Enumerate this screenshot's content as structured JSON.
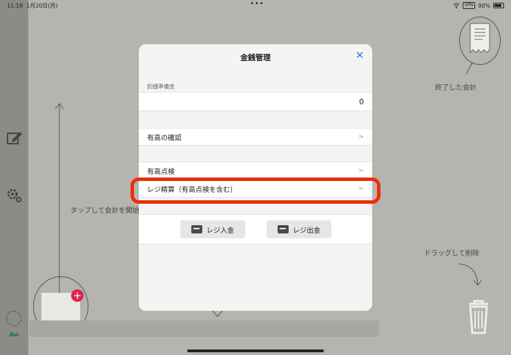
{
  "status_bar": {
    "time": "11:18",
    "date": "1月20日(月)",
    "vpn": "VPN",
    "battery": "90%"
  },
  "background": {
    "tap_hint": "タップして会計を開始",
    "finished_label": "終了した会計",
    "drag_hint": "ドラッグして削除"
  },
  "modal": {
    "title": "金銭管理",
    "section_label": "釣銭準備金",
    "change_fund_value": "0",
    "rows": [
      {
        "label": "有高の確認"
      },
      {
        "label": "有高点検"
      },
      {
        "label": "レジ精算（有高点検を含む）"
      }
    ],
    "buttons": {
      "deposit": "レジ入金",
      "withdraw": "レジ出金"
    }
  },
  "colors": {
    "accent": "#2b7de9",
    "highlight": "#f02b0a",
    "badge": "#e0244b"
  }
}
